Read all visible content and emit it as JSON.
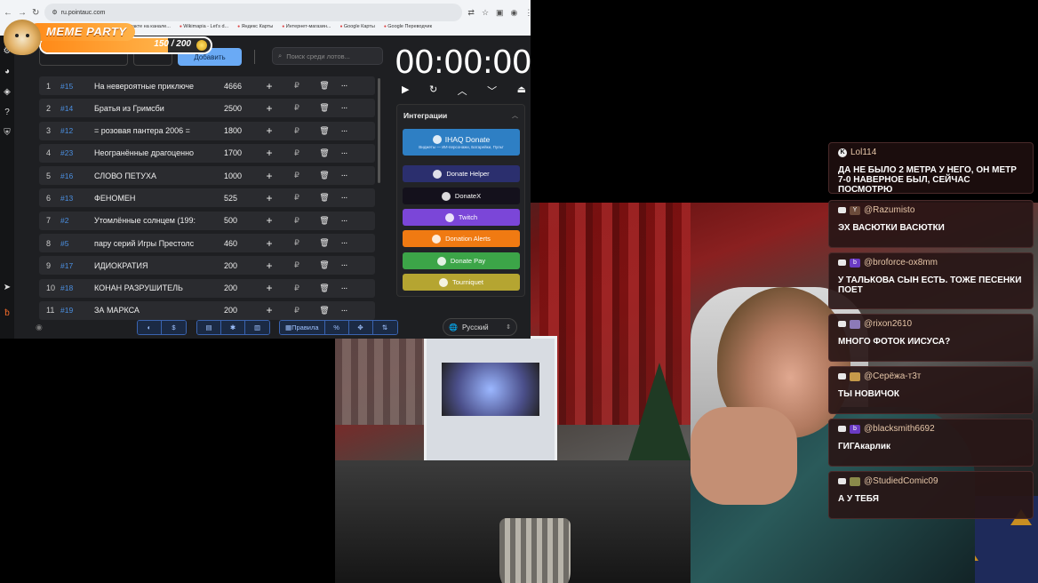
{
  "browser": {
    "url": "ru.pointauc.com",
    "bookmarks": [
      "Вконтакте на канале...",
      "Wikimapia - Let's d...",
      "Яндекс Карты",
      "Интернет-магазин...",
      "Google Карты",
      "Google Переводчик"
    ]
  },
  "meme_party": {
    "title": "MEME PARTY",
    "count": "150 / 200",
    "progress_fraction": 0.75
  },
  "toolbar": {
    "add_label": "Добавить",
    "search_placeholder": "Поиск среди лотов..."
  },
  "lots": [
    {
      "idx": "1",
      "num": "#15",
      "name": "На невероятные приключе",
      "amount": "4666"
    },
    {
      "idx": "2",
      "num": "#14",
      "name": " Братья из Гримсби",
      "amount": "2500"
    },
    {
      "idx": "3",
      "num": "#12",
      "name": "= розовая пантера 2006 =",
      "amount": "1800"
    },
    {
      "idx": "4",
      "num": "#23",
      "name": "Неогранённые драгоценно",
      "amount": "1700"
    },
    {
      "idx": "5",
      "num": "#16",
      "name": "СЛОВО ПЕТУХА",
      "amount": "1000"
    },
    {
      "idx": "6",
      "num": "#13",
      "name": "ФЕНОМЕН",
      "amount": "525"
    },
    {
      "idx": "7",
      "num": "#2",
      "name": "Утомлённые солнцем (199:",
      "amount": "500"
    },
    {
      "idx": "8",
      "num": "#5",
      "name": "пару серий Игры Престолс",
      "amount": "460"
    },
    {
      "idx": "9",
      "num": "#17",
      "name": "ИДИОКРАТИЯ",
      "amount": "200"
    },
    {
      "idx": "10",
      "num": "#18",
      "name": " КОНАН РАЗРУШИТЕЛЬ",
      "amount": "200"
    },
    {
      "idx": "11",
      "num": "#19",
      "name": "ЗА МАРКСА",
      "amount": "200"
    }
  ],
  "lot_actions": {
    "plus": "+",
    "currency": "₽",
    "delete": "🗑",
    "more": "···"
  },
  "timer": {
    "value": "00:00:00"
  },
  "integrations": {
    "title": "Интеграции",
    "buttons": [
      {
        "label": "IHAQ Donate",
        "sub": "Виджеты — ИИ-персонажи, Батарейки, Пульт",
        "color": "#2e7fc4"
      },
      {
        "label": "Donate Helper",
        "color": "#2b2f6e"
      },
      {
        "label": "DonateX",
        "color": "#14111c"
      },
      {
        "label": "Twitch",
        "color": "#7b46d8"
      },
      {
        "label": "Donation Alerts",
        "color": "#f07a12"
      },
      {
        "label": "Donate Pay",
        "color": "#3ca548"
      },
      {
        "label": "Tourniquet",
        "color": "#b5a531"
      }
    ]
  },
  "bottom_bar": {
    "rules_label": "Правила",
    "percent_label": "%",
    "language": "Русский"
  },
  "chat": [
    {
      "user": "Lol114",
      "platform": "kick",
      "text": "ДА НЕ БЫЛО 2 МЕТРА У НЕГО, ОН МЕТР 7-0 НАВЕРНОЕ БЫЛ, СЕЙЧАС ПОСМОТРЮ"
    },
    {
      "user": "@Razumisto",
      "platform": "youtube",
      "badge": "Y",
      "badge_color": "#6b4a3a",
      "text": "ЭХ ВАСЮТКИ ВАСЮТКИ"
    },
    {
      "user": "@broforce-ox8mm",
      "platform": "youtube",
      "badge": "b",
      "badge_color": "#6a3bc4",
      "text": "У ТАЛЬКОВА СЫН ЕСТЬ. ТОЖЕ ПЕСЕНКИ ПОЕТ"
    },
    {
      "user": "@rixon2610",
      "platform": "youtube",
      "badge": "",
      "badge_color": "#8c7ab8",
      "text": "МНОГО ФОТОК ИИСУСА?"
    },
    {
      "user": "@Серёжа-т3т",
      "platform": "youtube",
      "badge": "",
      "badge_color": "#c59a4a",
      "text": "ТЫ НОВИЧОК"
    },
    {
      "user": "@blacksmith6692",
      "platform": "youtube",
      "badge": "b",
      "badge_color": "#6a3bc4",
      "text": "ГИГАкарлик"
    },
    {
      "user": "@StudiedComic09",
      "platform": "youtube",
      "badge": "",
      "badge_color": "#8a8a4a",
      "text": "А У ТЕБЯ"
    }
  ]
}
